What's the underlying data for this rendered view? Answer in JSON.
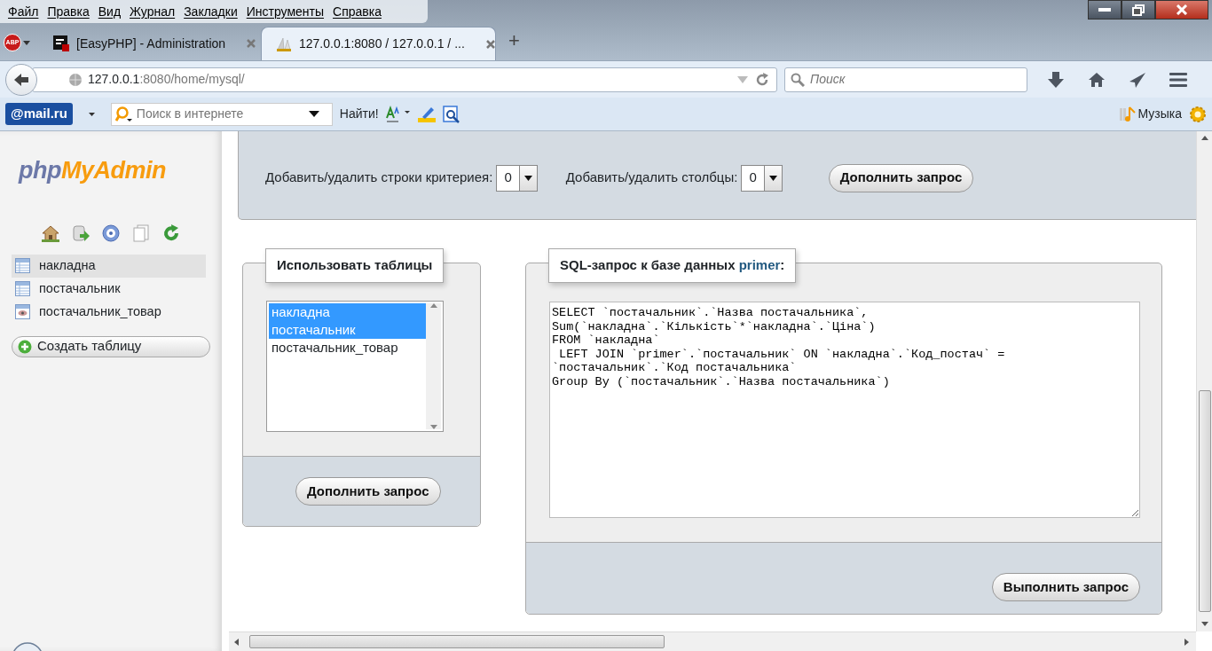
{
  "menu": [
    {
      "label": "Файл"
    },
    {
      "label": "Правка"
    },
    {
      "label": "Вид"
    },
    {
      "label": "Журнал"
    },
    {
      "label": "Закладки"
    },
    {
      "label": "Инструменты"
    },
    {
      "label": "Справка"
    }
  ],
  "abp_label": "ABP",
  "tabs": [
    {
      "title": "[EasyPHP] - Administration",
      "selected": false,
      "kind": "square"
    },
    {
      "title": "127.0.0.1:8080 / 127.0.0.1 / ...",
      "selected": true,
      "kind": "sail"
    }
  ],
  "new_tab": "+",
  "address": {
    "host": "127.0.0.1",
    "path": ":8080/home/mysql/"
  },
  "browser_search": {
    "placeholder": "Поиск"
  },
  "mail_toolbar": {
    "logo": "@mail.ru",
    "search_placeholder": "Поиск в интернете",
    "find_button": "Найти!",
    "music": "Музыка"
  },
  "sidebar": {
    "logo_php": "php",
    "logo_myadmin": "MyAdmin",
    "tables": [
      {
        "name": "накладна",
        "selected": true,
        "kind": "table"
      },
      {
        "name": "постачальник",
        "selected": false,
        "kind": "table"
      },
      {
        "name": "постачальник_товар",
        "selected": false,
        "kind": "view"
      }
    ],
    "create_button": "Создать таблицу"
  },
  "criteria": {
    "rows_label": "Добавить/удалить строки критериея:",
    "rows_value": "0",
    "cols_label": "Добавить/удалить столбцы:",
    "cols_value": "0",
    "button": "Дополнить запрос"
  },
  "use_tables": {
    "legend": "Использовать таблицы",
    "options": [
      {
        "name": "накладна",
        "selected": true
      },
      {
        "name": "постачальник",
        "selected": true
      },
      {
        "name": "постачальник_товар",
        "selected": false
      }
    ],
    "button": "Дополнить запрос"
  },
  "sql": {
    "legend_prefix": "SQL-запрос к базе данных",
    "database": "primer",
    "legend_suffix": ":",
    "query": "SELECT `постачальник`.`Назва постачальника`,\nSum(`накладна`.`Кількість`*`накладна`.`Ціна`)\nFROM `накладна`\n LEFT JOIN `primer`.`постачальник` ON `накладна`.`Код_постач` =\n`постачальник`.`Код постачальника`\nGroup By (`постачальник`.`Назва постачальника`)",
    "button": "Выполнить запрос"
  }
}
